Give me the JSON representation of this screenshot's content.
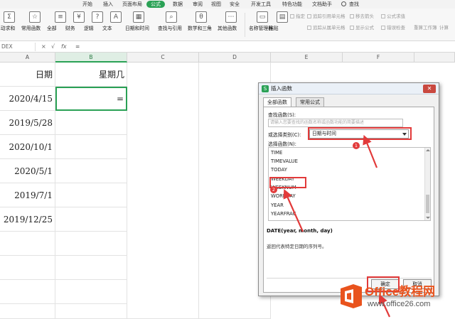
{
  "menubar": {
    "tabs": [
      "开始",
      "插入",
      "页面布局",
      "公式",
      "数据",
      "审阅",
      "视图",
      "安全",
      "开发工具",
      "特色功能",
      "文档助手"
    ],
    "active": "公式",
    "search": "查找"
  },
  "ribbon": {
    "buttons": [
      "自动求和",
      "常用函数",
      "全部",
      "财务",
      "逻辑",
      "文本",
      "日期和时间",
      "查找与引用",
      "数学和三角",
      "其他函数",
      "名称管理器",
      "粘贴"
    ],
    "small": [
      "指定",
      "追踪引用单元格",
      "追踪从属单元格",
      "移去箭头",
      "显示公式",
      "公式求值",
      "错误检查",
      "重算工作簿",
      "计算"
    ]
  },
  "formula_bar": {
    "name_box": "DEX",
    "cancel": "×",
    "confirm": "√",
    "fx": "fx",
    "content": "="
  },
  "sheet": {
    "columns": [
      "A",
      "B",
      "C",
      "D",
      "E",
      "F"
    ],
    "header_row": {
      "a": "日期",
      "b": "星期几"
    },
    "dates": [
      "2020/4/15",
      "2019/5/28",
      "2020/10/1",
      "2020/5/1",
      "2019/7/1",
      "2019/12/25"
    ],
    "b2": "="
  },
  "dialog": {
    "title": "插入函数",
    "tabs": [
      "全部函数",
      "常用公式"
    ],
    "search_label": "查找函数(S):",
    "search_placeholder": "请输入您要查找的函数名称或函数功能的简要描述",
    "category_label": "或选择类别(C):",
    "category_value": "日期与时间",
    "list_label": "选择函数(N):",
    "functions": [
      "TIME",
      "TIMEVALUE",
      "TODAY",
      "WEEKDAY",
      "WEEKNUM",
      "WORKDAY",
      "YEAR",
      "YEARFRAC"
    ],
    "signature": "DATE(year, month, day)",
    "description": "返回代表特定日期的序列号。",
    "ok": "确定",
    "cancel": "取消",
    "markers": [
      "1",
      "2"
    ]
  },
  "watermark": {
    "brand": "Office教程网",
    "url": "www.office26.com"
  },
  "colors": {
    "accent": "#2aa155",
    "highlight": "#e23a3a",
    "brand_orange": "#e9531d"
  }
}
